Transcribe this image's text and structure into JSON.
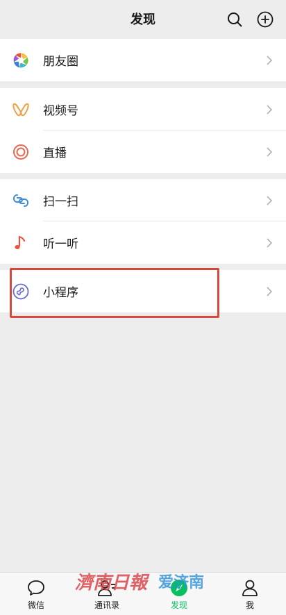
{
  "header": {
    "title": "发现"
  },
  "groups": [
    {
      "items": [
        {
          "label": "朋友圈",
          "icon": "moments-icon"
        }
      ]
    },
    {
      "items": [
        {
          "label": "视频号",
          "icon": "channels-icon"
        },
        {
          "label": "直播",
          "icon": "live-icon"
        }
      ]
    },
    {
      "items": [
        {
          "label": "扫一扫",
          "icon": "scan-icon"
        },
        {
          "label": "听一听",
          "icon": "music-note-icon"
        }
      ]
    },
    {
      "items": [
        {
          "label": "小程序",
          "icon": "mini-program-icon"
        }
      ]
    }
  ],
  "tabbar": {
    "tabs": [
      {
        "label": "微信",
        "icon": "chat-bubble-icon",
        "active": false
      },
      {
        "label": "通讯录",
        "icon": "contacts-icon",
        "active": false
      },
      {
        "label": "发现",
        "icon": "discover-compass-icon",
        "active": true
      },
      {
        "label": "我",
        "icon": "person-icon",
        "active": false
      }
    ]
  },
  "watermark": {
    "text_left": "濟南日報",
    "text_right": "爱济南"
  },
  "colors": {
    "background": "#ededed",
    "accent_green": "#07c160",
    "highlight_red": "#d5483d",
    "channels_orange": "#f0a24a",
    "live_red": "#e8674f",
    "scan_blue": "#3f8bd6",
    "music_red": "#e8553e",
    "mini_program_purple": "#6b6bd6"
  }
}
